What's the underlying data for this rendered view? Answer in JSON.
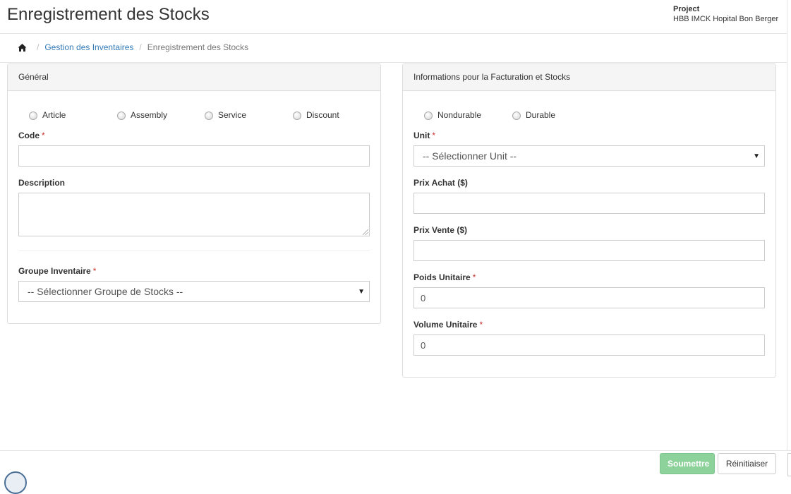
{
  "header": {
    "title": "Enregistrement des Stocks",
    "project_label": "Project",
    "project_name": "HBB IMCK Hopital Bon Berger"
  },
  "breadcrumb": {
    "home_icon": "home-icon",
    "items": [
      "Gestion des Inventaires",
      "Enregistrement des Stocks"
    ],
    "separator": "/"
  },
  "general_panel": {
    "heading": "Général",
    "type_options": [
      "Article",
      "Assembly",
      "Service",
      "Discount"
    ],
    "code_label": "Code",
    "code_value": "",
    "description_label": "Description",
    "description_value": "",
    "group_label": "Groupe Inventaire",
    "group_selected": "-- Sélectionner Groupe de Stocks --"
  },
  "billing_panel": {
    "heading": "Informations pour la Facturation et Stocks",
    "durability_options": [
      "Nondurable",
      "Durable"
    ],
    "unit_label": "Unit",
    "unit_selected": "-- Sélectionner Unit --",
    "prix_achat_label": "Prix Achat ($)",
    "prix_achat_value": "",
    "prix_vente_label": "Prix Vente ($)",
    "prix_vente_value": "",
    "poids_label": "Poids Unitaire",
    "poids_value": "0",
    "volume_label": "Volume Unitaire",
    "volume_value": "0"
  },
  "required_marker": "*",
  "footer": {
    "submit_label": "Soumettre",
    "reset_label": "Réinitiaiser"
  },
  "colors": {
    "link": "#337ab7",
    "required": "#c9302c",
    "submit_bg": "#8dd19b"
  }
}
